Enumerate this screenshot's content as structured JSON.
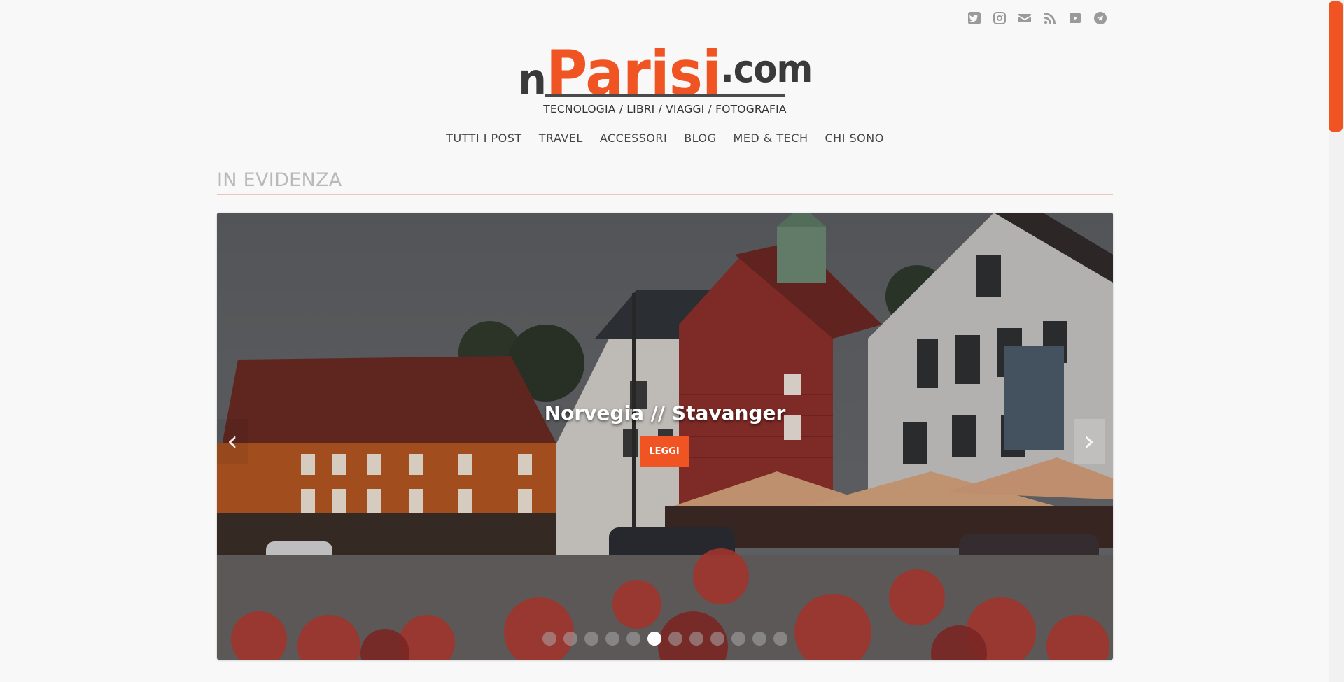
{
  "header": {
    "social_icons": [
      "twitter-icon",
      "instagram-icon",
      "email-icon",
      "rss-icon",
      "youtube-icon",
      "telegram-icon"
    ],
    "logo": {
      "prefix": "n",
      "main": "Parisi",
      "suffix": ".com"
    },
    "tagline": "TECNOLOGIA / LIBRI / VIAGGI / FOTOGRAFIA"
  },
  "nav": {
    "items": [
      {
        "label": "TUTTI I POST"
      },
      {
        "label": "TRAVEL"
      },
      {
        "label": "ACCESSORI"
      },
      {
        "label": "BLOG"
      },
      {
        "label": "MED & TECH"
      },
      {
        "label": "CHI SONO"
      }
    ]
  },
  "featured": {
    "title": "IN EVIDENZA",
    "slide": {
      "caption": "Norvegia // Stavanger",
      "button_label": "LEGGI",
      "prev_label": "‹",
      "next_label": "›"
    },
    "dots_total": 12,
    "active_dot_index": 5
  },
  "colors": {
    "accent": "#f05423",
    "text": "#333333",
    "muted": "#b9b9b9"
  }
}
